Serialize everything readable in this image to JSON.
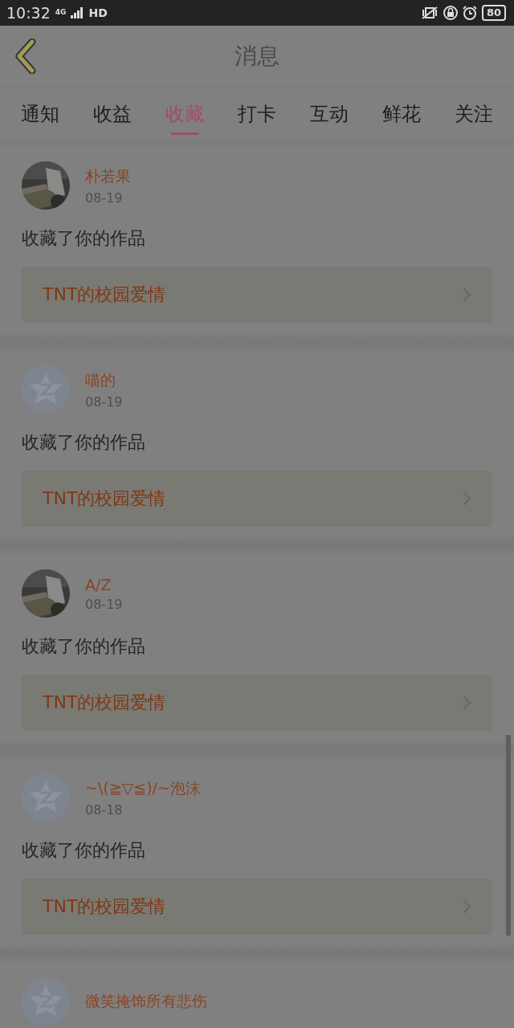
{
  "status_bar": {
    "time": "10:32",
    "network": "4G",
    "hd": "HD",
    "battery": "80"
  },
  "header": {
    "title": "消息"
  },
  "tabs": [
    {
      "label": "通知",
      "selected": false
    },
    {
      "label": "收益",
      "selected": false
    },
    {
      "label": "收藏",
      "selected": true
    },
    {
      "label": "打卡",
      "selected": false
    },
    {
      "label": "互动",
      "selected": false
    },
    {
      "label": "鲜花",
      "selected": false
    },
    {
      "label": "关注",
      "selected": false
    }
  ],
  "messages": [
    {
      "name": "朴若果",
      "date": "08-19",
      "text": "收藏了你的作品",
      "work": "TNT的校园爱情"
    },
    {
      "kind": "default",
      "name": "喵的",
      "date": "08-19",
      "text": "收藏了你的作品",
      "work": "TNT的校园爱情"
    },
    {
      "name": "A/Z",
      "date": "08-19",
      "text": "收藏了你的作品",
      "work": "TNT的校园爱情"
    },
    {
      "kind": "default",
      "name": "~\\(≧▽≦)/~泡沫",
      "date": "08-18",
      "text": "收藏了你的作品",
      "work": "TNT的校园爱情"
    },
    {
      "kind": "default",
      "name": "微笑掩饰所有悲伤"
    }
  ]
}
